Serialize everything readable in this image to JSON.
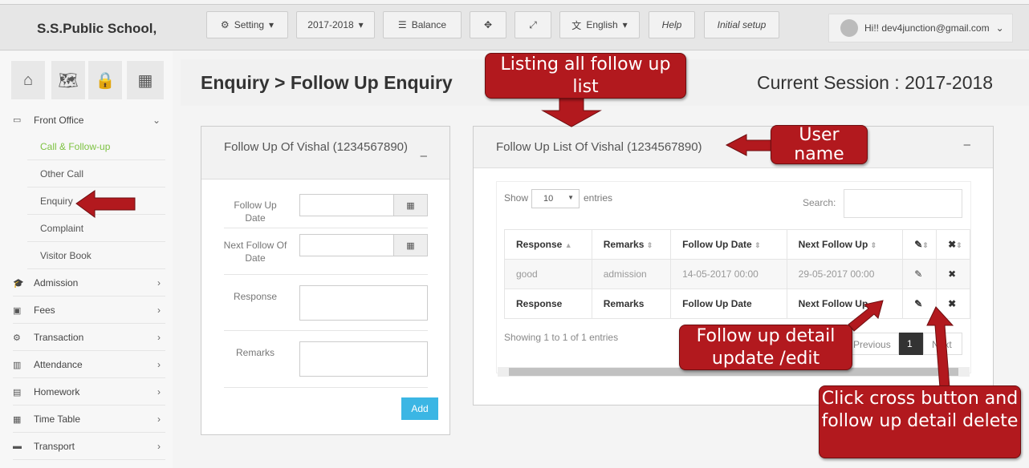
{
  "brand": "S.S.Public School,",
  "toolbar": {
    "setting": "Setting",
    "session": "2017-2018",
    "balance": "Balance",
    "language": "English",
    "help": "Help",
    "initial_setup": "Initial setup",
    "user": "Hi!! dev4junction@gmail.com"
  },
  "sidebar": {
    "front_office": "Front Office",
    "sub": [
      "Call & Follow-up",
      "Other Call",
      "Enquiry",
      "Complaint",
      "Visitor Book"
    ],
    "items": [
      "Admission",
      "Fees",
      "Transaction",
      "Attendance",
      "Homework",
      "Time Table",
      "Transport"
    ]
  },
  "page": {
    "title": "Enquiry > Follow Up Enquiry",
    "session": "Current Session : 2017-2018"
  },
  "form": {
    "title": "Follow Up Of Vishal (1234567890)",
    "follow_up_date": "Follow Up Date",
    "next_follow_date": "Next Follow Of Date",
    "response": "Response",
    "remarks": "Remarks",
    "add": "Add"
  },
  "list": {
    "title": "Follow Up List Of Vishal (1234567890)",
    "show": "Show",
    "entries_value": "10",
    "entries": "entries",
    "search": "Search:",
    "headers": [
      "Response",
      "Remarks",
      "Follow Up Date",
      "Next Follow Up"
    ],
    "rows": [
      [
        "good",
        "admission",
        "14-05-2017 00:00",
        "29-05-2017 00:00"
      ]
    ],
    "footer": [
      "Response",
      "Remarks",
      "Follow Up Date",
      "Next Follow Up"
    ],
    "info": "Showing 1 to 1 of 1 entries",
    "previous": "Previous",
    "page": "1",
    "next": "Next"
  },
  "callouts": {
    "listing": "Listing all follow up list",
    "user": "User name",
    "edit": "Follow up detail update /edit",
    "delete": "Click cross button and follow up detail delete"
  },
  "colors": {
    "callout": "#b2191e",
    "active_menu": "#7dc242",
    "add_button": "#3bb6e4"
  }
}
